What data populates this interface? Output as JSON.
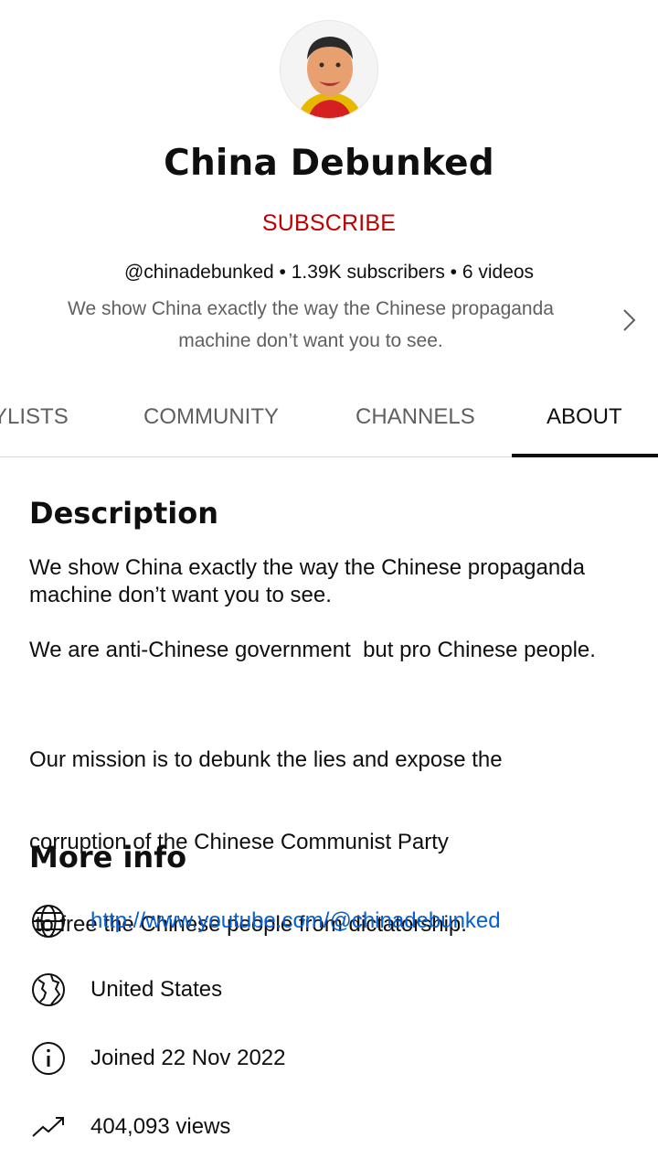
{
  "channel": {
    "name": "China Debunked",
    "subscribe_label": "SUBSCRIBE",
    "meta": "@chinadebunked • 1.39K subscribers • 6 videos",
    "tagline_line1": "We show China exactly the way the Chinese propaganda",
    "tagline_line2": "machine don’t want you to see."
  },
  "tabs": [
    {
      "label": "YLISTS"
    },
    {
      "label": "COMMUNITY"
    },
    {
      "label": "CHANNELS"
    },
    {
      "label": "ABOUT",
      "active": true
    }
  ],
  "description": {
    "title": "Description",
    "para1_line1": "We show China exactly the way the Chinese propaganda",
    "para1_line2": "machine don’t want you to see.",
    "para2": "We are anti-Chinese government  but pro Chinese people.",
    "para3_line1": "Our mission is to debunk the lies and expose the",
    "para3_line2": "corruption of the Chinese Communist Party",
    "para3_line3": " to free the Chinese people from dictatorship."
  },
  "more_info": {
    "title": "More info",
    "items": [
      {
        "icon": "globe-icon",
        "text": "http://www.youtube.com/@chinadebunked"
      },
      {
        "icon": "map-globe-icon",
        "text": "United States"
      },
      {
        "icon": "info-icon",
        "text": "Joined 22 Nov 2022"
      },
      {
        "icon": "trending-icon",
        "text": "404,093 views"
      }
    ]
  },
  "colors": {
    "subscribe": "#c00000",
    "link": "#065fd4",
    "secondary_text": "#606060"
  }
}
